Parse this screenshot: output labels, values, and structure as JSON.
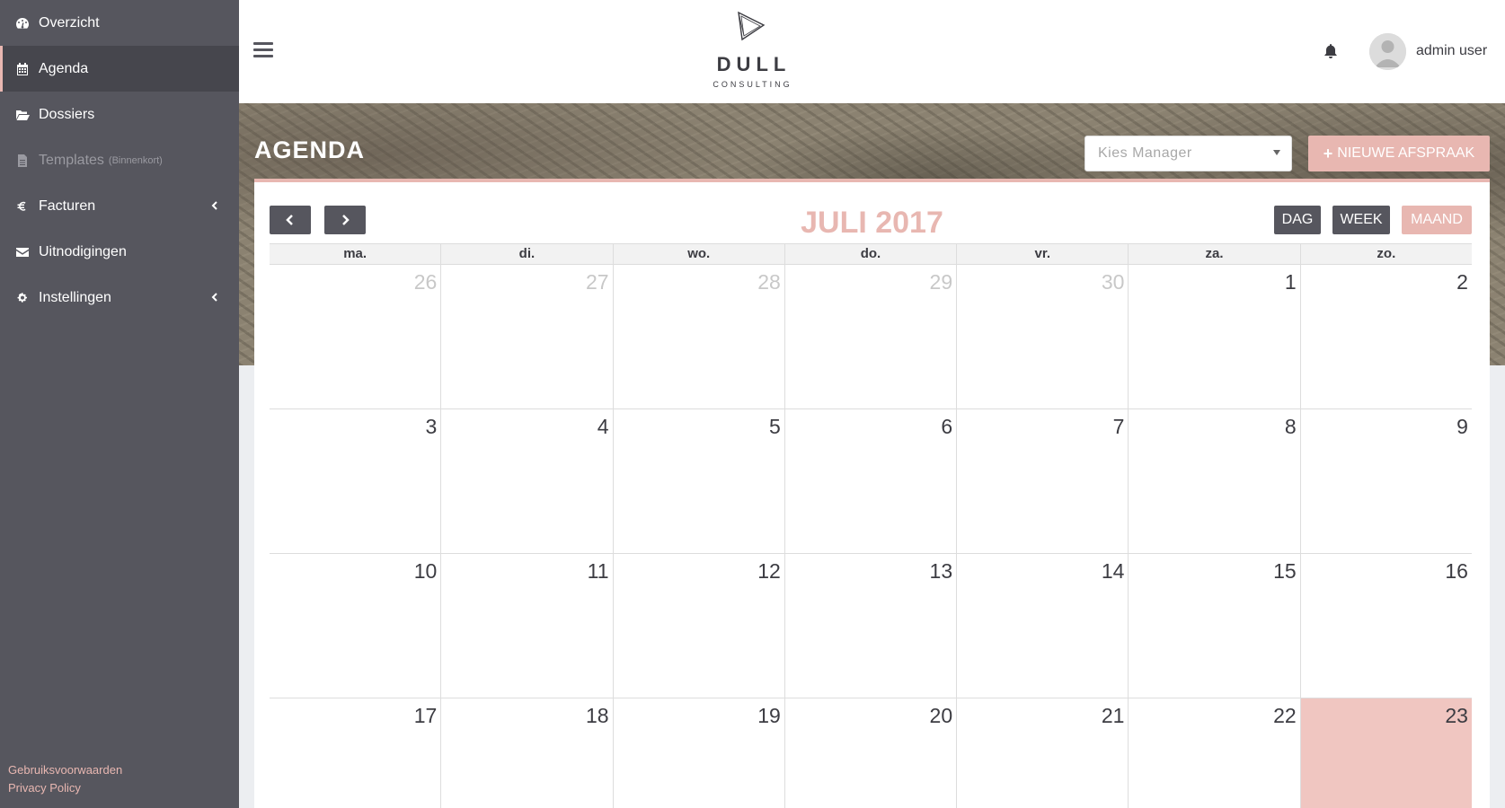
{
  "sidebar": {
    "items": [
      {
        "label": "Overzicht",
        "icon": "dashboard-icon"
      },
      {
        "label": "Agenda",
        "icon": "calendar-icon",
        "active": true
      },
      {
        "label": "Dossiers",
        "icon": "folder-open-icon"
      },
      {
        "label": "Templates",
        "sublabel": "(Binnenkort)",
        "icon": "file-icon",
        "disabled": true
      },
      {
        "label": "Facturen",
        "icon": "euro-icon",
        "has_children": true
      },
      {
        "label": "Uitnodigingen",
        "icon": "envelope-icon"
      },
      {
        "label": "Instellingen",
        "icon": "gears-icon",
        "has_children": true
      }
    ],
    "footer": {
      "terms": "Gebruiksvoorwaarden",
      "privacy": "Privacy Policy"
    }
  },
  "header": {
    "brand_name": "DULL",
    "brand_sub": "CONSULTING",
    "user_name": "admin user"
  },
  "page": {
    "title": "AGENDA",
    "manager_select": {
      "value": "Kies Manager"
    },
    "new_button": "NIEUWE AFSPRAAK"
  },
  "calendar": {
    "title": "JULI 2017",
    "views": {
      "day": "DAG",
      "week": "WEEK",
      "month": "MAAND",
      "active": "month"
    },
    "weekdays": [
      "ma.",
      "di.",
      "wo.",
      "do.",
      "vr.",
      "za.",
      "zo."
    ],
    "weeks": [
      [
        {
          "d": "26",
          "other": true
        },
        {
          "d": "27",
          "other": true
        },
        {
          "d": "28",
          "other": true
        },
        {
          "d": "29",
          "other": true
        },
        {
          "d": "30",
          "other": true
        },
        {
          "d": "1"
        },
        {
          "d": "2"
        }
      ],
      [
        {
          "d": "3"
        },
        {
          "d": "4"
        },
        {
          "d": "5"
        },
        {
          "d": "6"
        },
        {
          "d": "7"
        },
        {
          "d": "8"
        },
        {
          "d": "9"
        }
      ],
      [
        {
          "d": "10"
        },
        {
          "d": "11"
        },
        {
          "d": "12"
        },
        {
          "d": "13"
        },
        {
          "d": "14"
        },
        {
          "d": "15"
        },
        {
          "d": "16"
        }
      ],
      [
        {
          "d": "17"
        },
        {
          "d": "18"
        },
        {
          "d": "19"
        },
        {
          "d": "20"
        },
        {
          "d": "21"
        },
        {
          "d": "22"
        },
        {
          "d": "23",
          "today": true
        }
      ]
    ]
  },
  "colors": {
    "accent": "#e8b7b1",
    "sidebar_bg": "#56565e",
    "today_bg": "#f0c6c1"
  }
}
